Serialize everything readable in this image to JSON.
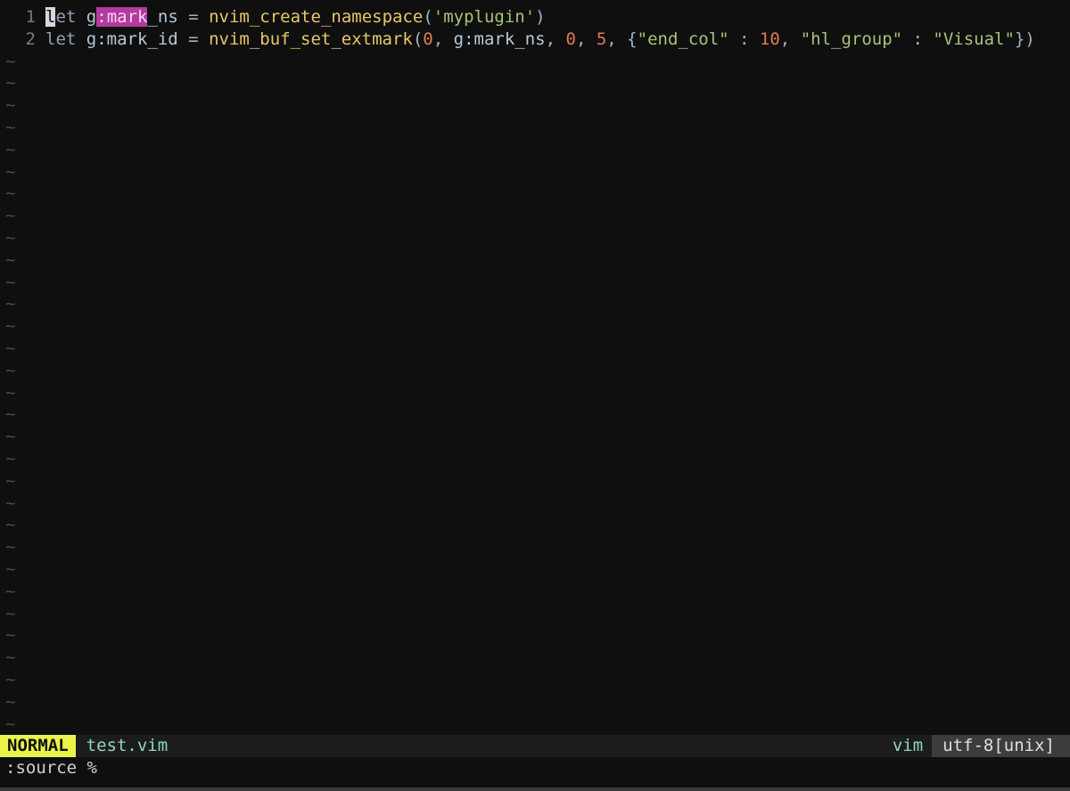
{
  "buffer": {
    "lines": [
      {
        "number": "1",
        "tokens": [
          {
            "text": "l",
            "cls": "cursor"
          },
          {
            "text": "et",
            "cls": "kw"
          },
          {
            "text": " ",
            "cls": "plain"
          },
          {
            "text": "g",
            "cls": "var"
          },
          {
            "text": ":mark",
            "cls": "mark"
          },
          {
            "text": "_ns",
            "cls": "var"
          },
          {
            "text": " = ",
            "cls": "plain"
          },
          {
            "text": "nvim_create_namespace",
            "cls": "fn"
          },
          {
            "text": "(",
            "cls": "punc"
          },
          {
            "text": "'myplugin'",
            "cls": "str"
          },
          {
            "text": ")",
            "cls": "punc"
          }
        ]
      },
      {
        "number": "2",
        "tokens": [
          {
            "text": "let",
            "cls": "kw"
          },
          {
            "text": " ",
            "cls": "plain"
          },
          {
            "text": "g:mark_id",
            "cls": "var"
          },
          {
            "text": " = ",
            "cls": "plain"
          },
          {
            "text": "nvim_buf_set_extmark",
            "cls": "fn"
          },
          {
            "text": "(",
            "cls": "punc"
          },
          {
            "text": "0",
            "cls": "num"
          },
          {
            "text": ", ",
            "cls": "plain"
          },
          {
            "text": "g:mark_ns",
            "cls": "var"
          },
          {
            "text": ", ",
            "cls": "plain"
          },
          {
            "text": "0",
            "cls": "num"
          },
          {
            "text": ", ",
            "cls": "plain"
          },
          {
            "text": "5",
            "cls": "num"
          },
          {
            "text": ", ",
            "cls": "plain"
          },
          {
            "text": "{",
            "cls": "punc"
          },
          {
            "text": "\"end_col\"",
            "cls": "str"
          },
          {
            "text": " : ",
            "cls": "plain"
          },
          {
            "text": "10",
            "cls": "num"
          },
          {
            "text": ", ",
            "cls": "plain"
          },
          {
            "text": "\"hl_group\"",
            "cls": "str"
          },
          {
            "text": " : ",
            "cls": "plain"
          },
          {
            "text": "\"Visual\"",
            "cls": "str"
          },
          {
            "text": "})",
            "cls": "punc"
          }
        ]
      }
    ],
    "empty_marker": "~",
    "empty_line_count": 31
  },
  "statusline": {
    "mode": "NORMAL",
    "filename": "test.vim",
    "filetype": "vim",
    "encoding": "utf-8[unix]"
  },
  "cmdline": {
    "text": ":source %"
  },
  "colors": {
    "background": "#0f0f0f",
    "mode_bg": "#eaf34a",
    "visual_highlight": "#b43aa0",
    "function": "#e6c76a",
    "string": "#a7c27a",
    "number": "#e07a55"
  }
}
